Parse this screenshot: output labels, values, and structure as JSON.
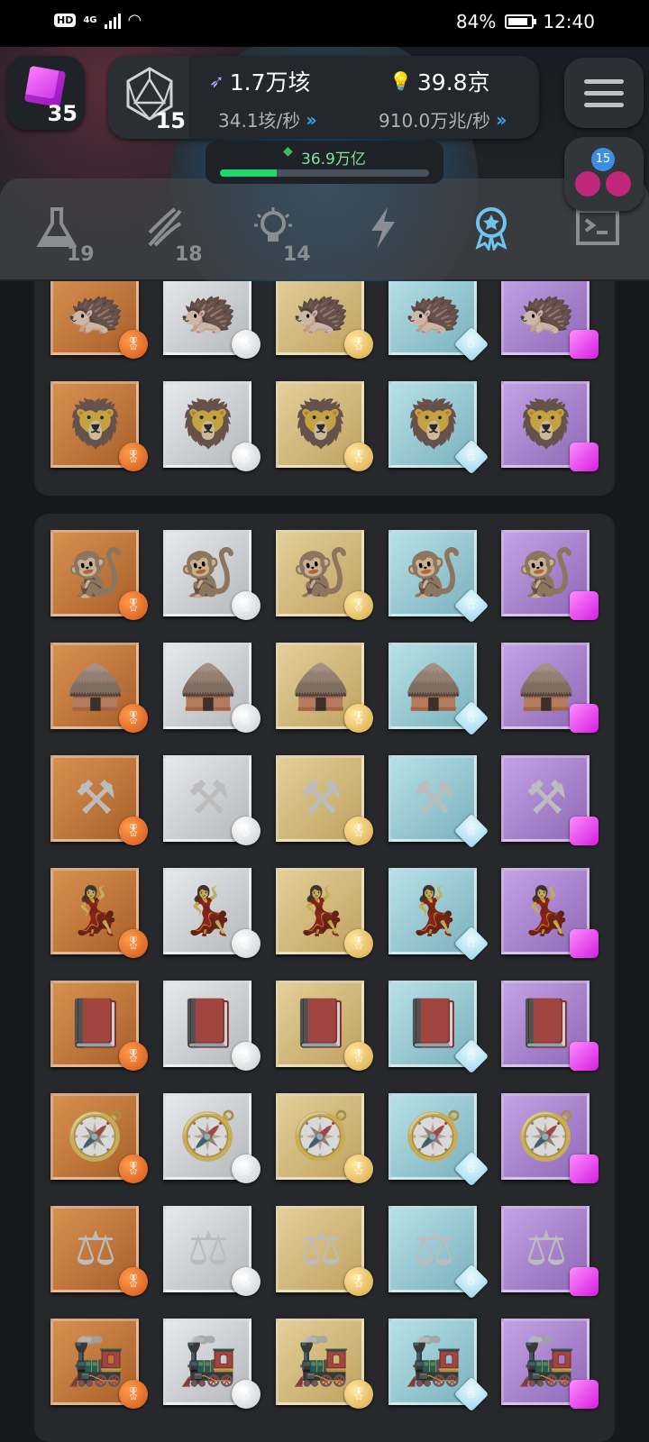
{
  "status_bar": {
    "network": "4G",
    "hd": "HD",
    "battery": "84%",
    "battery_level": 0.84,
    "time": "12:40"
  },
  "hud": {
    "cube_count": "35",
    "d20_count": "15",
    "resource1_amount": "1.7万垓",
    "resource1_rate": "34.1垓/秒",
    "resource2_amount": "39.8京",
    "resource2_rate": "910.0万兆/秒",
    "progress_label": "36.9万亿",
    "progress": 0.27,
    "avatar_badge": "15"
  },
  "tabs": [
    {
      "icon": "flask-icon",
      "badge": "19"
    },
    {
      "icon": "dna-icon",
      "badge": "18"
    },
    {
      "icon": "lightbulb-icon",
      "badge": "14"
    },
    {
      "icon": "lightning-icon",
      "badge": ""
    },
    {
      "icon": "award-ribbon-icon",
      "badge": "",
      "active": true
    },
    {
      "icon": "terminal-icon",
      "badge": ""
    }
  ],
  "tiers": [
    {
      "name": "bronze",
      "color": "#c97a3c"
    },
    {
      "name": "silver",
      "color": "#c5c8cc"
    },
    {
      "name": "gold",
      "color": "#cdb57a"
    },
    {
      "name": "diamond",
      "color": "#92c5cf"
    },
    {
      "name": "gem",
      "color": "#a98acb"
    }
  ],
  "sections": [
    {
      "rows": [
        {
          "subject": "hedgehog",
          "glyph": "🦔"
        },
        {
          "subject": "lion",
          "glyph": "🦁"
        }
      ]
    },
    {
      "rows": [
        {
          "subject": "chimpanzee-fire",
          "glyph": "🐒"
        },
        {
          "subject": "hut",
          "glyph": "🛖"
        },
        {
          "subject": "anvil-hammer",
          "glyph": "⚒"
        },
        {
          "subject": "dancing-figures",
          "glyph": "💃"
        },
        {
          "subject": "book",
          "glyph": "📕"
        },
        {
          "subject": "sextant",
          "glyph": "🧭"
        },
        {
          "subject": "balance-scale",
          "glyph": "⚖"
        },
        {
          "subject": "locomotive",
          "glyph": "🚂"
        }
      ]
    }
  ]
}
